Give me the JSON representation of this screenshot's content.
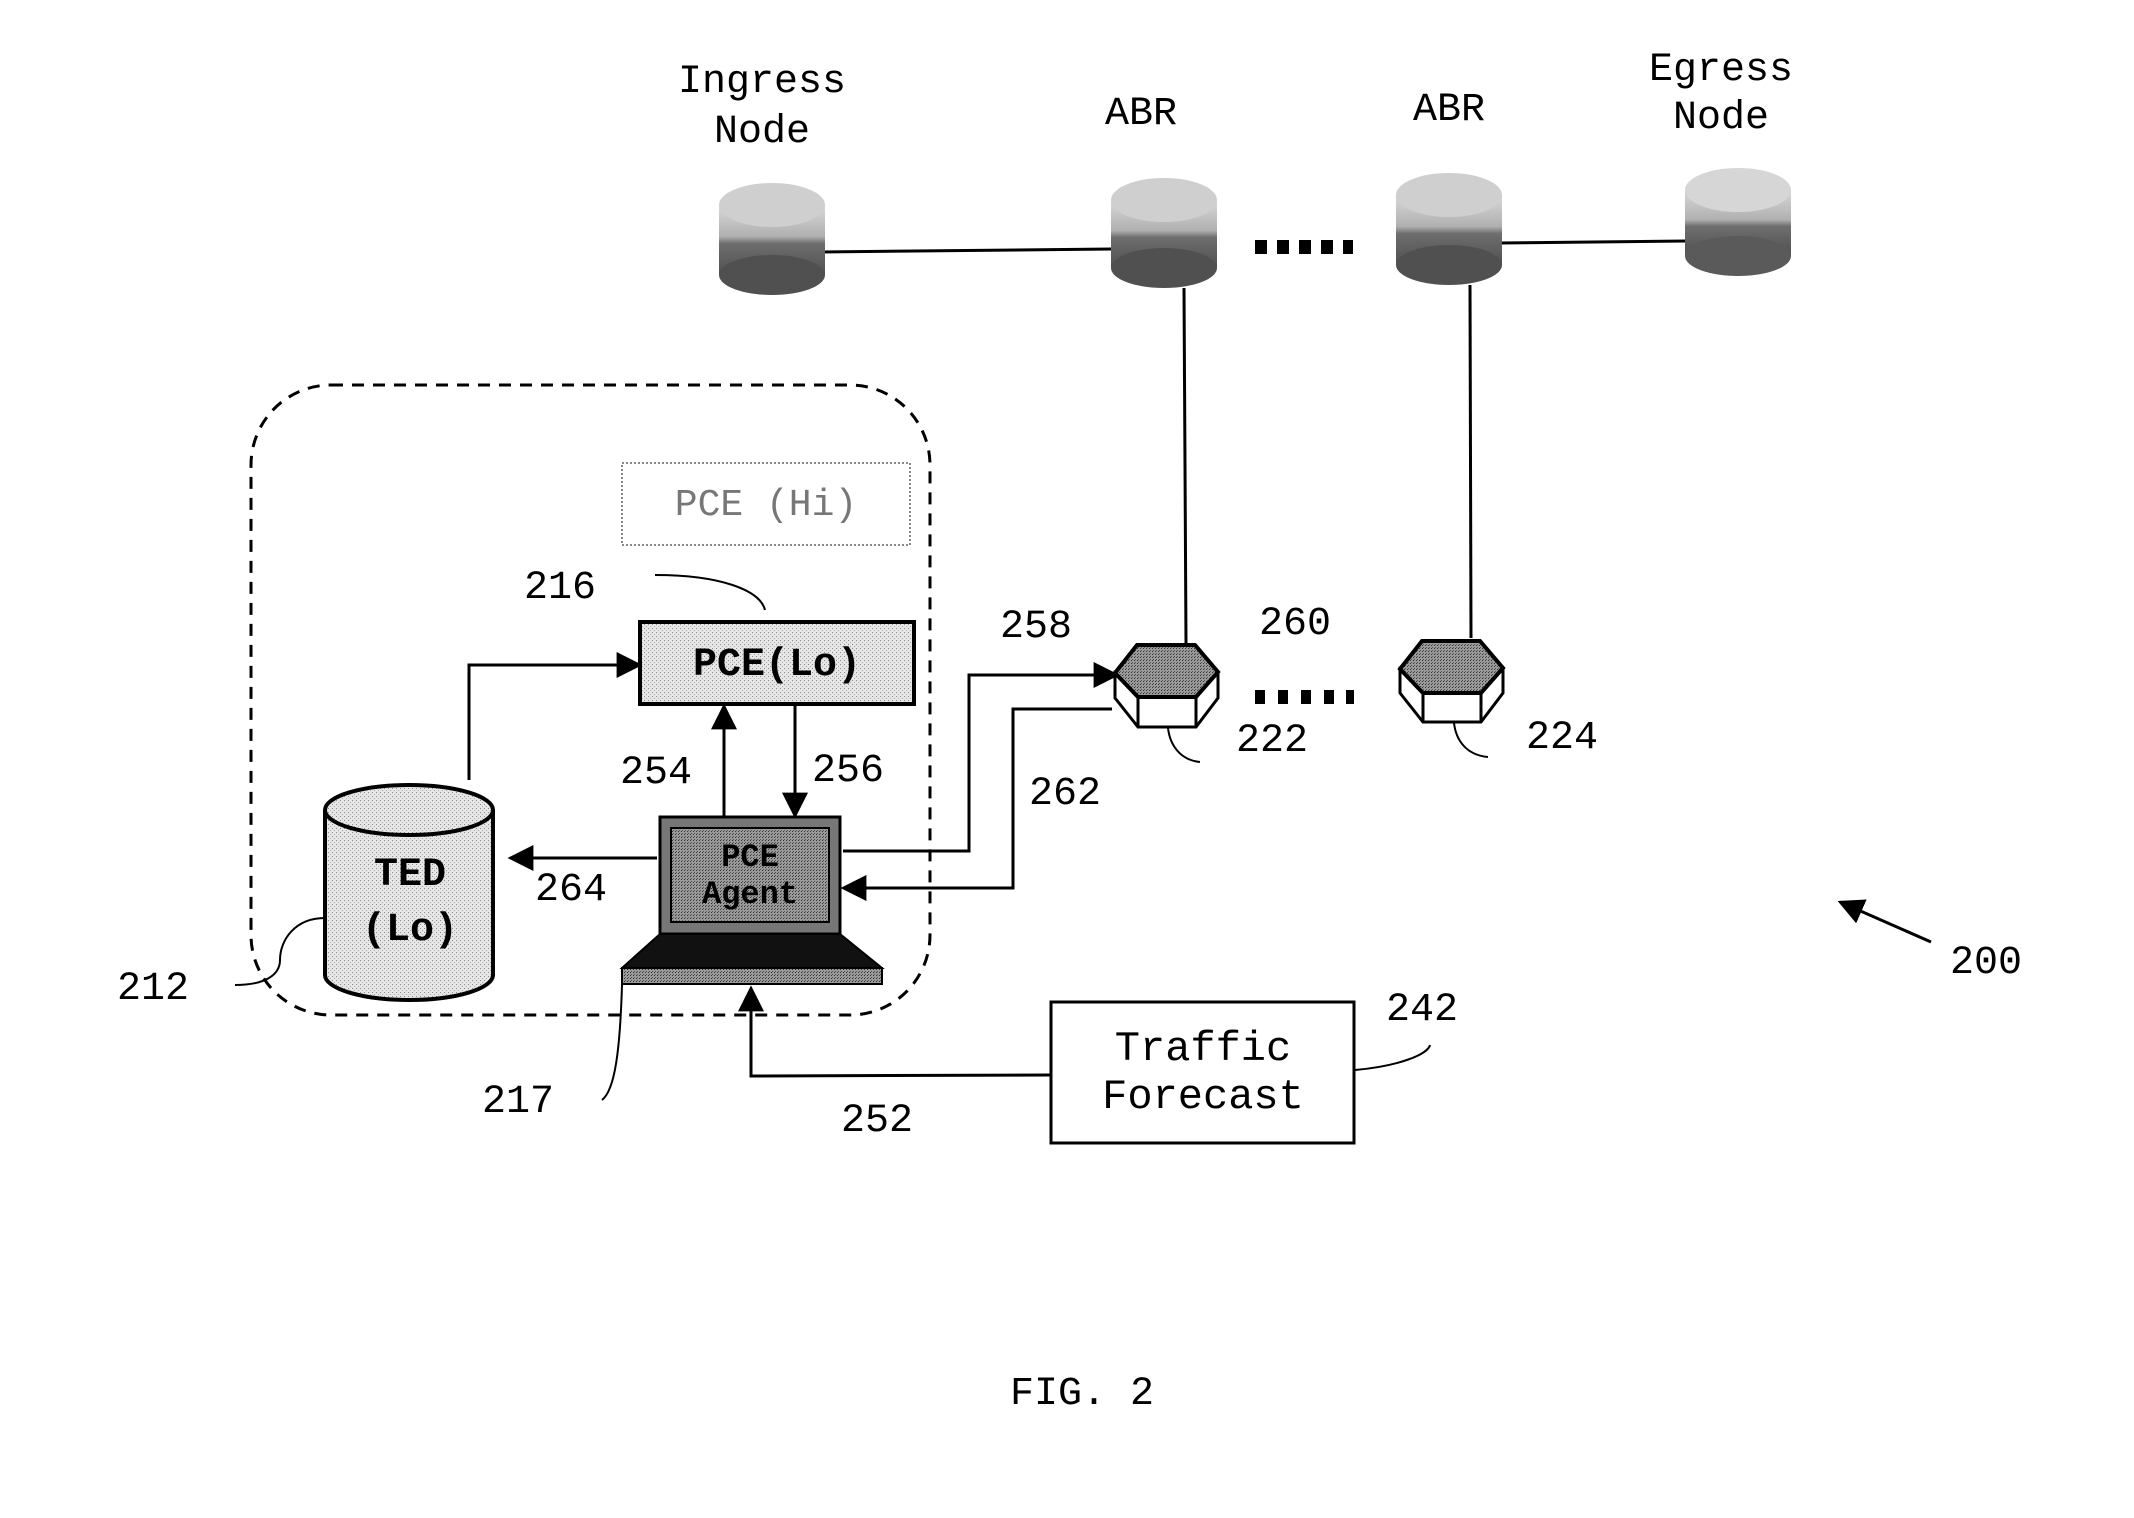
{
  "figure": {
    "caption": "FIG. 2",
    "reference_number": "200"
  },
  "top_nodes": [
    {
      "id": "ingress",
      "label_lines": [
        "Ingress",
        "Node"
      ]
    },
    {
      "id": "abr1",
      "label_lines": [
        "ABR"
      ]
    },
    {
      "id": "abr2",
      "label_lines": [
        "ABR"
      ]
    },
    {
      "id": "egress",
      "label_lines": [
        "Egress",
        "Node"
      ]
    }
  ],
  "domain_box": {
    "pce_hi": "PCE (Hi)",
    "pce_lo": "PCE(Lo)",
    "pce_lo_ref": "216",
    "ted_lines": [
      "TED",
      "(Lo)"
    ],
    "ted_ref": "212",
    "agent_lines": [
      "PCE",
      "Agent"
    ],
    "agent_ref": "217"
  },
  "arrows": {
    "agent_to_pce": "254",
    "pce_to_agent": "256",
    "agent_to_ted": "264",
    "agent_to_router": "258",
    "router_to_agent": "262",
    "forecast_to_agent": "252",
    "router_chain": "260"
  },
  "routers": [
    {
      "ref": "222"
    },
    {
      "ref": "224"
    }
  ],
  "traffic_forecast": {
    "label_lines": [
      "Traffic",
      "Forecast"
    ],
    "ref": "242"
  }
}
